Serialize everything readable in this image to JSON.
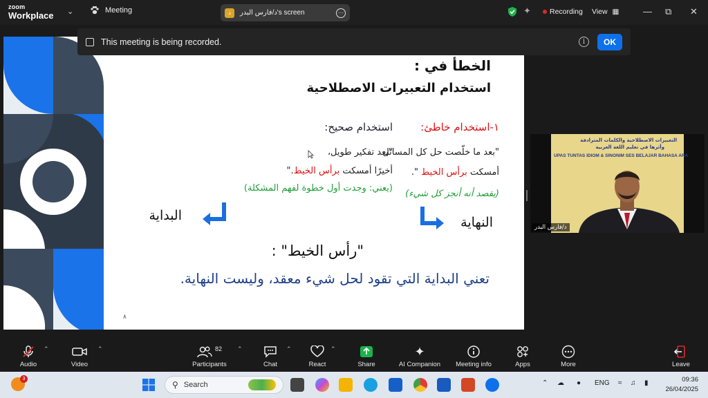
{
  "titlebar": {
    "brand_small": "zoom",
    "brand_big": "Workplace",
    "meeting_label": "Meeting",
    "screen_share_label": "د/فارس البدر's screen",
    "screen_share_avatar": "د",
    "recording_label": "Recording",
    "view_label": "View"
  },
  "banner": {
    "message": "This meeting is being recorded.",
    "ok_label": "OK"
  },
  "slide": {
    "title_line1": "الخطأ في :",
    "title_line2": "استخدام التعبيرات الاصطلاحية",
    "wrong_heading": "١-استخدام خاطئ:",
    "wrong_line1": "\"بعد ما خلّصت حل كل المسائل",
    "wrong_line2_a": "أمسكت ",
    "wrong_line2_b": "برأس الخيط",
    "wrong_line2_c": " \".",
    "wrong_line3": "(يقصد أنه أنجز كل شيء)",
    "right_heading": "استخدام صحيح:",
    "right_line1": "\"بعد تفكير طويل،",
    "right_line2_a": "أخيرًا أمسكت ",
    "right_line2_b": "برأس الخيط",
    "right_line2_c": ".\"",
    "right_line3": "(يعني: وجدت أول خطوة لفهم المشكلة)",
    "end_label": "النهاية",
    "start_label": "البداية",
    "head_line": "\"رأس الخيط\" :",
    "meaning_line": "تعني البداية التي تقود لحل شيء معقد، وليست النهاية.",
    "slide_number": "٨"
  },
  "video": {
    "banner_line1": "التعبيرات الاصطلاحية والكلمات المترادفة",
    "banner_line2": "وأثرها في تعليم اللغة العربية",
    "banner_line3": "UPAS TUNTAS IDIOM & SINONIM SES BELAJAR BAHASA ARA",
    "participant_name": "د/فارس البدر"
  },
  "controls": {
    "audio": "Audio",
    "video": "Video",
    "participants": "Participants",
    "participants_count": "82",
    "chat": "Chat",
    "react": "React",
    "share": "Share",
    "ai_companion": "AI Companion",
    "meeting_info": "Meeting info",
    "apps": "Apps",
    "more": "More",
    "leave": "Leave"
  },
  "taskbar": {
    "weather_badge": "3",
    "search_placeholder": "Search",
    "language": "ENG",
    "time": "09:36",
    "date": "26/04/2025"
  },
  "colors": {
    "accent_blue": "#0e71eb",
    "share_green": "#19b34a",
    "leave_red": "#e02828",
    "slide_red": "#dd1111",
    "slide_green": "#1e9e36",
    "slide_blue_arrow": "#1a6fe0"
  }
}
